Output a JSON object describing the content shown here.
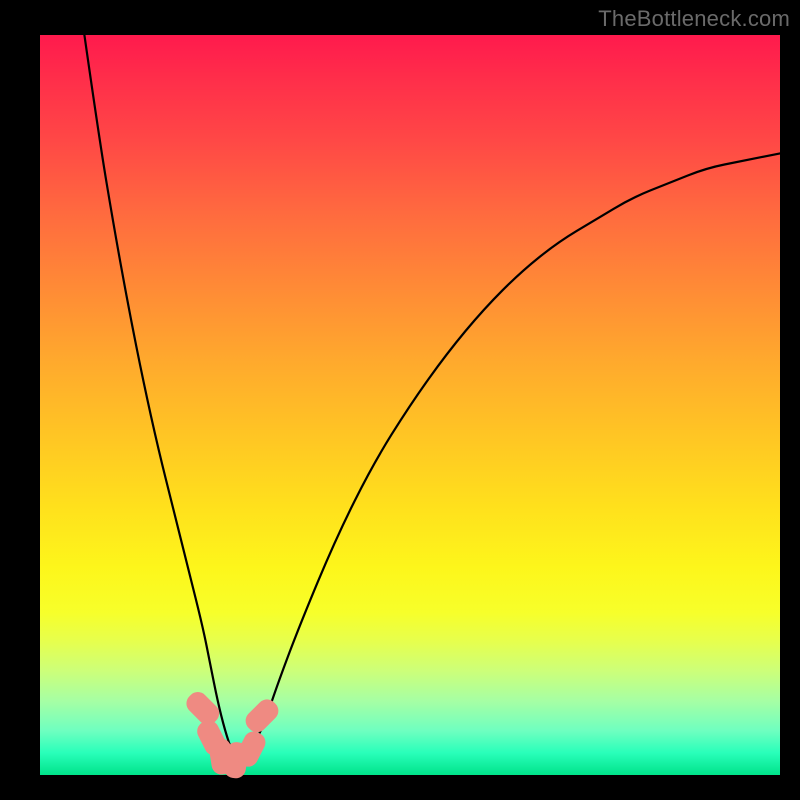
{
  "watermark": "TheBottleneck.com",
  "chart_data": {
    "type": "line",
    "title": "",
    "xlabel": "",
    "ylabel": "",
    "xlim": [
      0,
      100
    ],
    "ylim": [
      0,
      100
    ],
    "grid": false,
    "legend": false,
    "series": [
      {
        "name": "bottleneck-curve",
        "x": [
          6,
          8,
          10,
          12,
          14,
          16,
          18,
          20,
          22,
          23,
          24,
          25,
          26,
          27,
          28,
          30,
          32,
          35,
          40,
          45,
          50,
          55,
          60,
          65,
          70,
          75,
          80,
          85,
          90,
          95,
          100
        ],
        "values": [
          100,
          86,
          74,
          63,
          53,
          44,
          36,
          28,
          20,
          15,
          10,
          6,
          3,
          2,
          3,
          6,
          12,
          20,
          32,
          42,
          50,
          57,
          63,
          68,
          72,
          75,
          78,
          80,
          82,
          83,
          84
        ]
      }
    ],
    "markers": [
      {
        "x": 22.0,
        "y": 9.0
      },
      {
        "x": 23.2,
        "y": 5.0
      },
      {
        "x": 24.5,
        "y": 2.5
      },
      {
        "x": 26.5,
        "y": 2.0
      },
      {
        "x": 28.5,
        "y": 3.5
      },
      {
        "x": 30.0,
        "y": 8.0
      }
    ],
    "marker_color": "#ef8a82",
    "background_gradient": {
      "direction": "top-to-bottom",
      "stops": [
        {
          "pos": 0.0,
          "color": "#ff1a4d"
        },
        {
          "pos": 0.5,
          "color": "#ffc524"
        },
        {
          "pos": 0.78,
          "color": "#f7ff2a"
        },
        {
          "pos": 1.0,
          "color": "#00e38a"
        }
      ]
    }
  }
}
